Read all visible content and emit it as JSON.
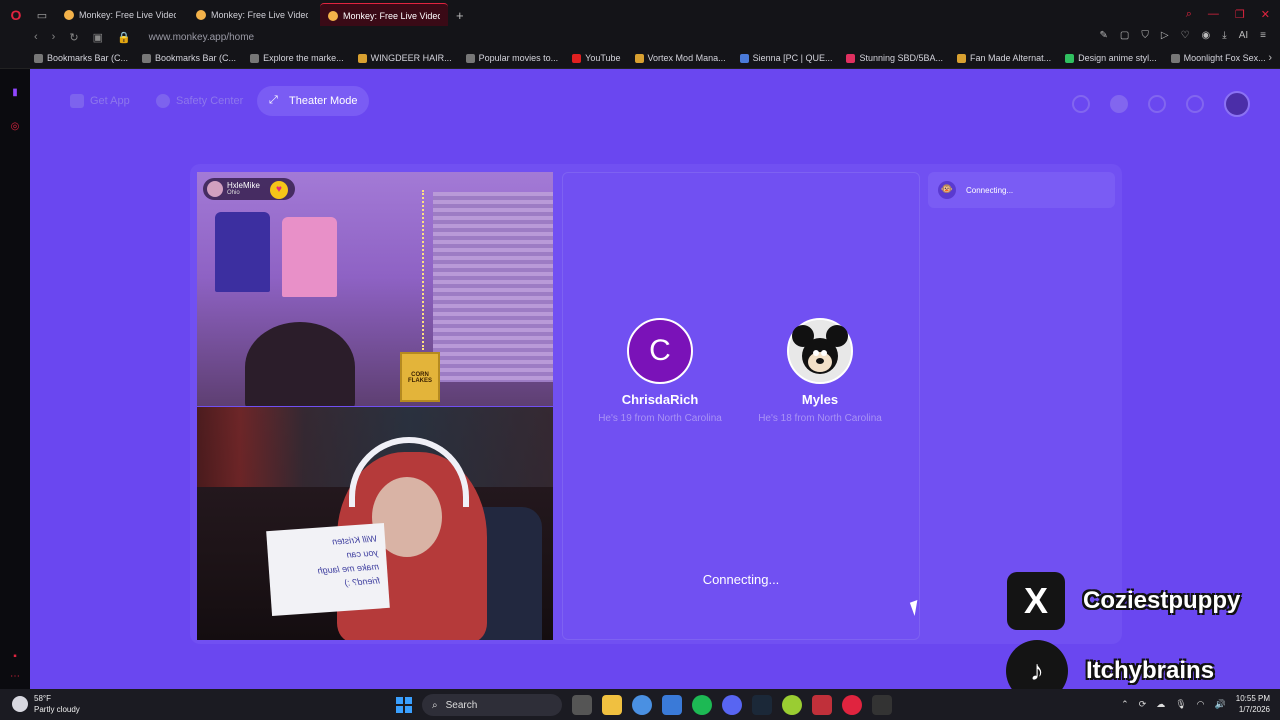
{
  "browser": {
    "tabs": [
      {
        "title": "Monkey: Free Live Video C",
        "active": false
      },
      {
        "title": "Monkey: Free Live Video C",
        "active": false
      },
      {
        "title": "Monkey: Free Live Video C",
        "active": true
      }
    ],
    "new_tab": "+",
    "url": "www.monkey.app/home",
    "bookmarks": [
      "Bookmarks Bar (C...",
      "Bookmarks Bar (C...",
      "Explore the marke...",
      "WINGDEER HAIR...",
      "Popular movies to...",
      "YouTube",
      "Vortex Mod Mana...",
      "Sienna [PC | QUE...",
      "Stunning SBD/5BA...",
      "Fan Made Alternat...",
      "Design anime styl...",
      "Moonlight Fox Sex..."
    ],
    "ai_label": "AI"
  },
  "nav": {
    "get_app": "Get App",
    "safety_center": "Safety Center",
    "theater_mode": "Theater Mode"
  },
  "video_top": {
    "username": "HxleMike",
    "location": "Ohio",
    "cereal_label": "CORN FLAKES"
  },
  "video_bottom": {
    "sign_lines": [
      "Will Kristen",
      "you can",
      "make me laugh",
      "friend? :)"
    ]
  },
  "matches": [
    {
      "initial": "C",
      "name": "ChrisdaRich",
      "info": "He's 19 from North Carolina",
      "avatar_color": "#7a12b8"
    },
    {
      "initial": "",
      "name": "Myles",
      "info": "He's 18 from North Carolina",
      "avatar_color": "#e8e8e8"
    }
  ],
  "status": {
    "connecting_main": "Connecting...",
    "connecting_chat": "Connecting..."
  },
  "socials": [
    {
      "platform": "x-icon",
      "glyph": "X",
      "handle": "Coziestpuppy"
    },
    {
      "platform": "tiktok-icon",
      "glyph": "♪",
      "handle": "Itchybrains"
    }
  ],
  "taskbar": {
    "temp": "58°F",
    "weather": "Partly cloudy",
    "search": "Search",
    "time": "10:55 PM",
    "date": "1/7/2026"
  },
  "colors": {
    "page_bg": "#6a47f0",
    "accent_red": "#e0243f"
  }
}
